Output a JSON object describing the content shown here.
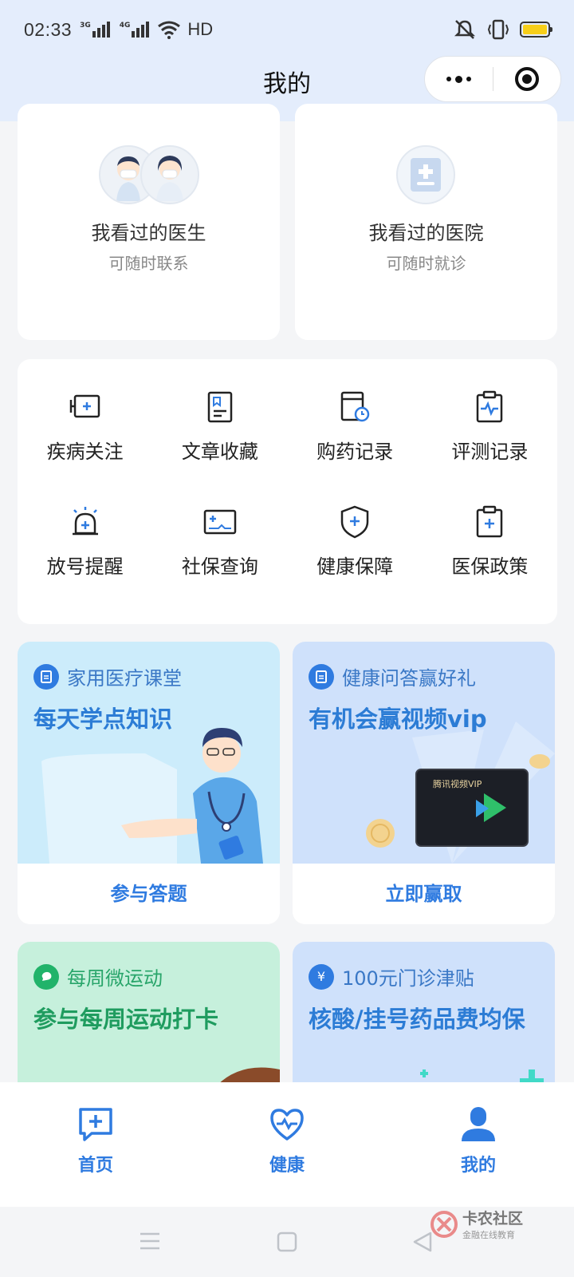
{
  "status_bar": {
    "time": "02:33",
    "net1": "3G",
    "net2": "4G",
    "hd": "HD"
  },
  "nav": {
    "title": "我的"
  },
  "visited": [
    {
      "title": "我看过的医生",
      "subtitle": "可随时联系"
    },
    {
      "title": "我看过的医院",
      "subtitle": "可随时就诊"
    }
  ],
  "services": [
    {
      "label": "疾病关注",
      "icon": "disease-follow-icon"
    },
    {
      "label": "文章收藏",
      "icon": "article-bookmark-icon"
    },
    {
      "label": "购药记录",
      "icon": "medicine-record-icon"
    },
    {
      "label": "评测记录",
      "icon": "assessment-record-icon"
    },
    {
      "label": "放号提醒",
      "icon": "alarm-bell-icon"
    },
    {
      "label": "社保查询",
      "icon": "social-insurance-icon"
    },
    {
      "label": "健康保障",
      "icon": "shield-plus-icon"
    },
    {
      "label": "医保政策",
      "icon": "clipboard-plus-icon"
    }
  ],
  "promos": [
    {
      "tag": "家用医疗课堂",
      "headline": "每天学点知识",
      "action": "参与答题"
    },
    {
      "tag": "健康问答赢好礼",
      "headline": "有机会赢视频vip",
      "action": "立即赢取",
      "card_label": "腾讯视频VIP"
    },
    {
      "tag": "每周微运动",
      "headline": "参与每周运动打卡"
    },
    {
      "tag": "100元门诊津贴",
      "headline": "核酸/挂号药品费均保",
      "tag_icon_text": "¥"
    }
  ],
  "tabs": [
    {
      "label": "首页"
    },
    {
      "label": "健康"
    },
    {
      "label": "我的"
    }
  ],
  "watermark": {
    "title": "卡农社区",
    "subtitle": "金融在线教育"
  },
  "colors": {
    "accent": "#2f7be0",
    "header_bg": "#e4edfc",
    "battery": "#f7cf19"
  }
}
